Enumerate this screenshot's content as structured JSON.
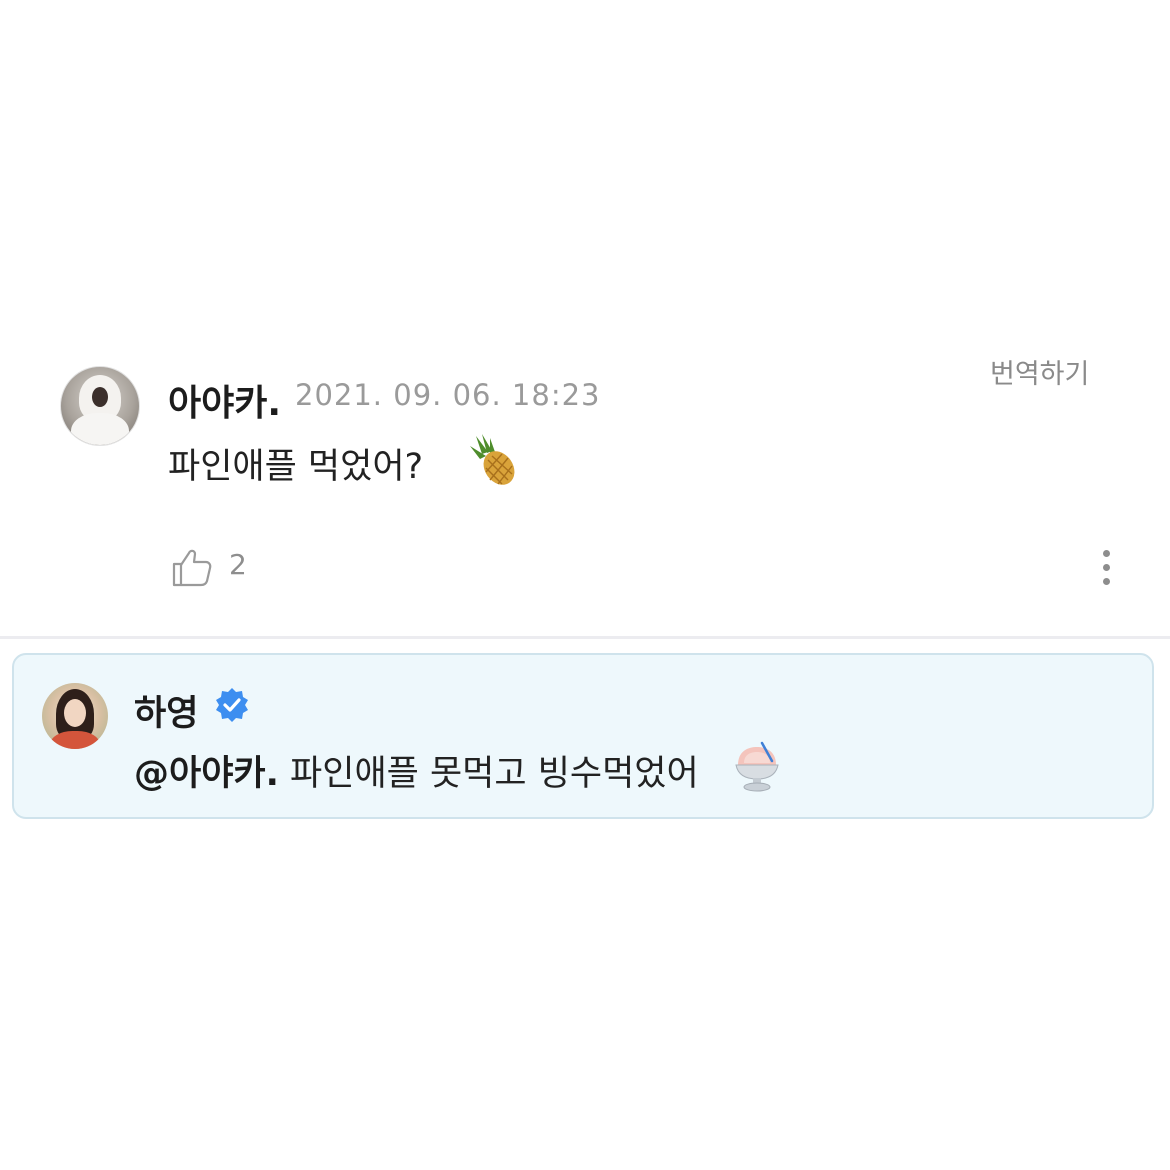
{
  "comment": {
    "author": "아야카.",
    "date": "2021. 09. 06. 18:23",
    "translate_label": "번역하기",
    "text": "파인애플 먹었어?",
    "emoji_icon": "pineapple-icon",
    "like_count": "2",
    "like_icon": "thumbs-up-icon",
    "more_icon": "vertical-dots-icon"
  },
  "reply": {
    "author": "하영",
    "verified_icon": "verified-badge-icon",
    "mention": "@아야카.",
    "text": "파인애플 못먹고 빙수먹었어",
    "emoji_icon": "shaved-ice-icon",
    "highlight_color": "#eef8fc",
    "border_color": "#cfe3ec"
  },
  "colors": {
    "verified_blue": "#3d8ef0",
    "muted_text": "#9a9a9a"
  }
}
